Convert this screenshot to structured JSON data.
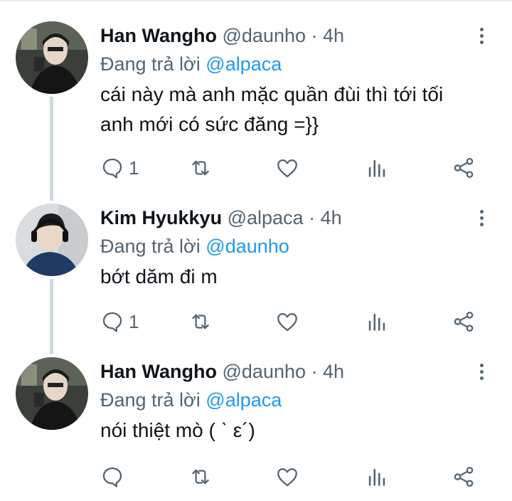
{
  "tweets": [
    {
      "name": "Han Wangho",
      "handle": "@daunho",
      "time": "· 4h",
      "reply_prefix": "Đang trả lời",
      "reply_to": "@alpaca",
      "text_lines": [
        "cái này mà anh mặc quần đùi thì tới tối",
        "anh mới có sức đăng =}}"
      ],
      "reply_count": "1",
      "avatar_icon": "avatar-photo"
    },
    {
      "name": "Kim Hyukkyu",
      "handle": "@alpaca",
      "time": "· 4h",
      "reply_prefix": "Đang trả lời",
      "reply_to": "@daunho",
      "text_lines": [
        "bớt dăm đi m"
      ],
      "reply_count": "1",
      "avatar_icon": "avatar-photo"
    },
    {
      "name": "Han Wangho",
      "handle": "@daunho",
      "time": "· 4h",
      "reply_prefix": "Đang trả lời",
      "reply_to": "@alpaca",
      "text_lines": [
        "nói thiệt mò ( ˋ ε´)"
      ],
      "reply_count": "",
      "avatar_icon": "avatar-photo"
    }
  ],
  "icons": [
    "comment-icon",
    "retweet-icon",
    "like-icon",
    "analytics-icon",
    "share-icon",
    "more-options-icon"
  ],
  "colors": {
    "link": "#1d9bf0",
    "muted": "#536471",
    "text": "#0f1419",
    "thread_line": "#cfd9de"
  }
}
